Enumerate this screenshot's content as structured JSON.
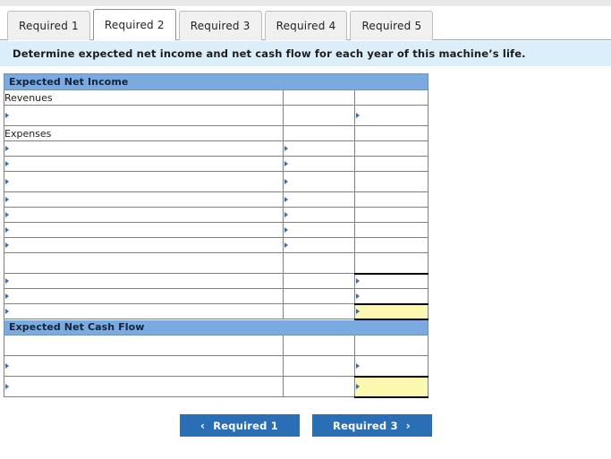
{
  "tabs": [
    {
      "label": "Required 1",
      "active": false
    },
    {
      "label": "Required 2",
      "active": true
    },
    {
      "label": "Required 3",
      "active": false
    },
    {
      "label": "Required 4",
      "active": false
    },
    {
      "label": "Required 5",
      "active": false
    }
  ],
  "instruction": "Determine expected net income and net cash flow for each year of this machine’s life.",
  "sections": {
    "net_income": {
      "header": "Expected Net Income",
      "labels": {
        "revenues": "Revenues",
        "expenses": "Expenses"
      }
    },
    "net_cash_flow": {
      "header": "Expected Net Cash Flow"
    }
  },
  "colors": {
    "section_header": "#7aaae0",
    "instruction_bar": "#ddeefb",
    "answer_cell": "#fcf8b0",
    "button": "#2a6eb5",
    "marker": "#40699e",
    "grid_line": "#808080"
  },
  "footer": {
    "prev_label": "Required 1",
    "prev_icon": "chevron-left-icon",
    "prev_chevron": "‹",
    "next_label": "Required 3",
    "next_icon": "chevron-right-icon",
    "next_chevron": "›"
  }
}
